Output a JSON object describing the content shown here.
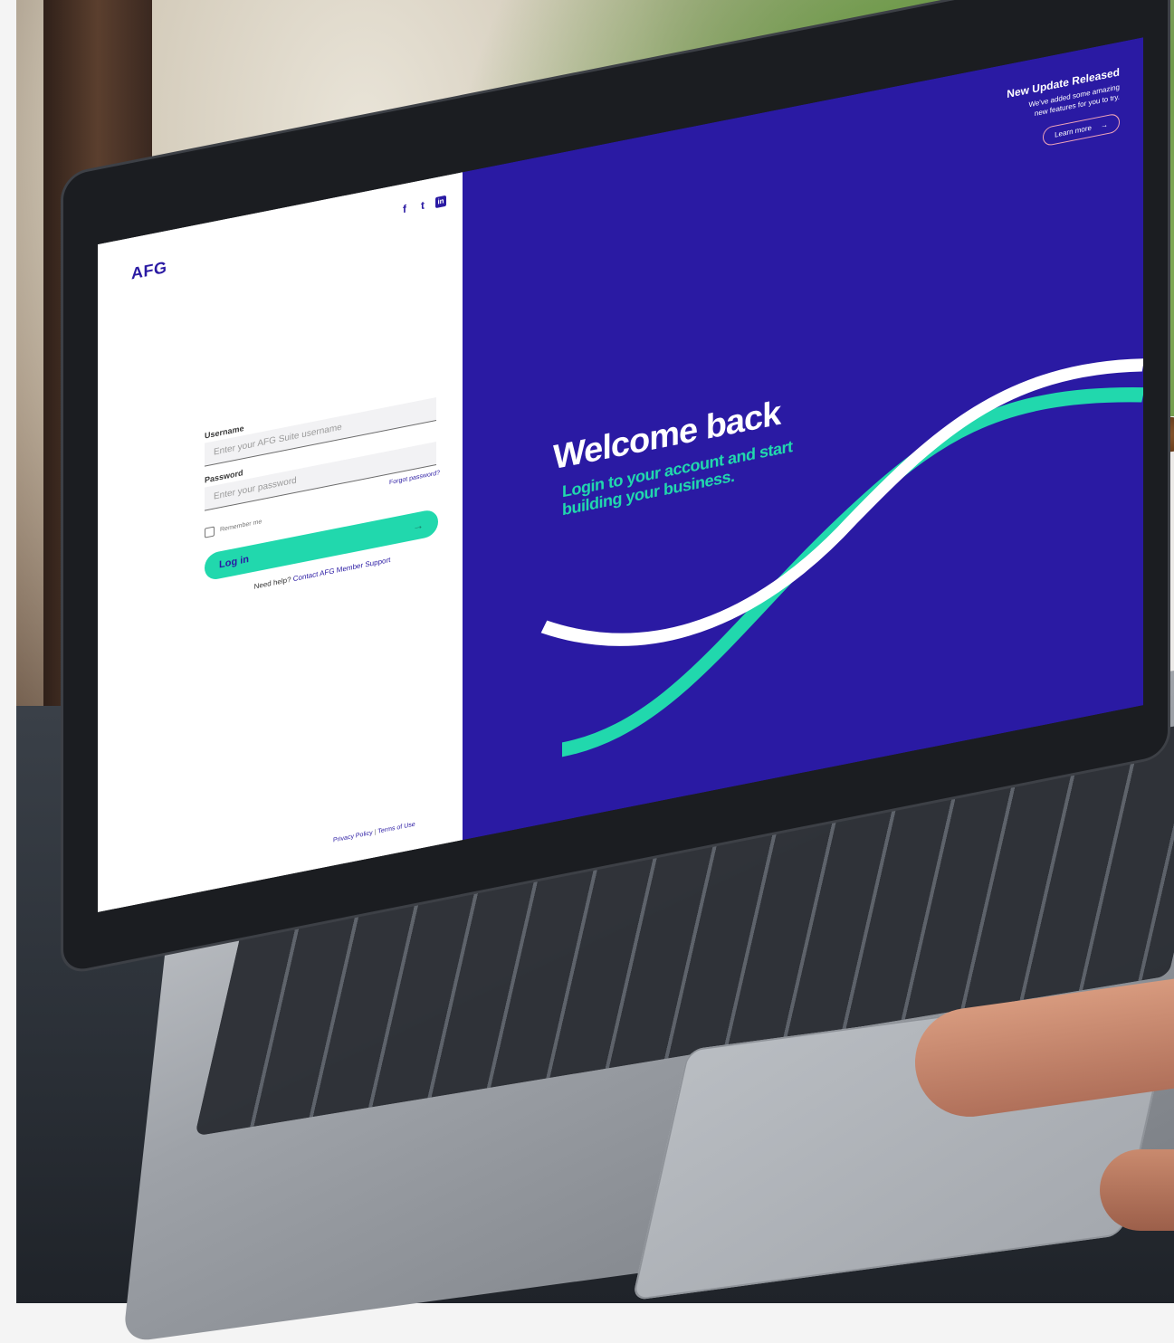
{
  "brand": {
    "logo": "AFG",
    "navy": "#2a1aa3",
    "mint": "#21d8ad"
  },
  "social_icons": [
    "facebook-icon",
    "twitter-icon",
    "linkedin-icon"
  ],
  "login_form": {
    "username_label": "Username",
    "username_placeholder": "Enter your AFG Suite username",
    "password_label": "Password",
    "password_placeholder": "Enter your password",
    "forgot_password": "Forgot password?",
    "remember_me": "Remember me",
    "login_button": "Log in",
    "help_text": "Need help?",
    "help_link": "Contact AFG Member Support"
  },
  "footer": {
    "privacy": "Privacy Policy",
    "separator": "|",
    "terms": "Terms of Use"
  },
  "update_banner": {
    "title": "New Update Released",
    "description": "We've added some amazing new features for you to try.",
    "button": "Learn more"
  },
  "hero": {
    "title": "Welcome back",
    "subtitle": "Login to your account and start building your business."
  }
}
